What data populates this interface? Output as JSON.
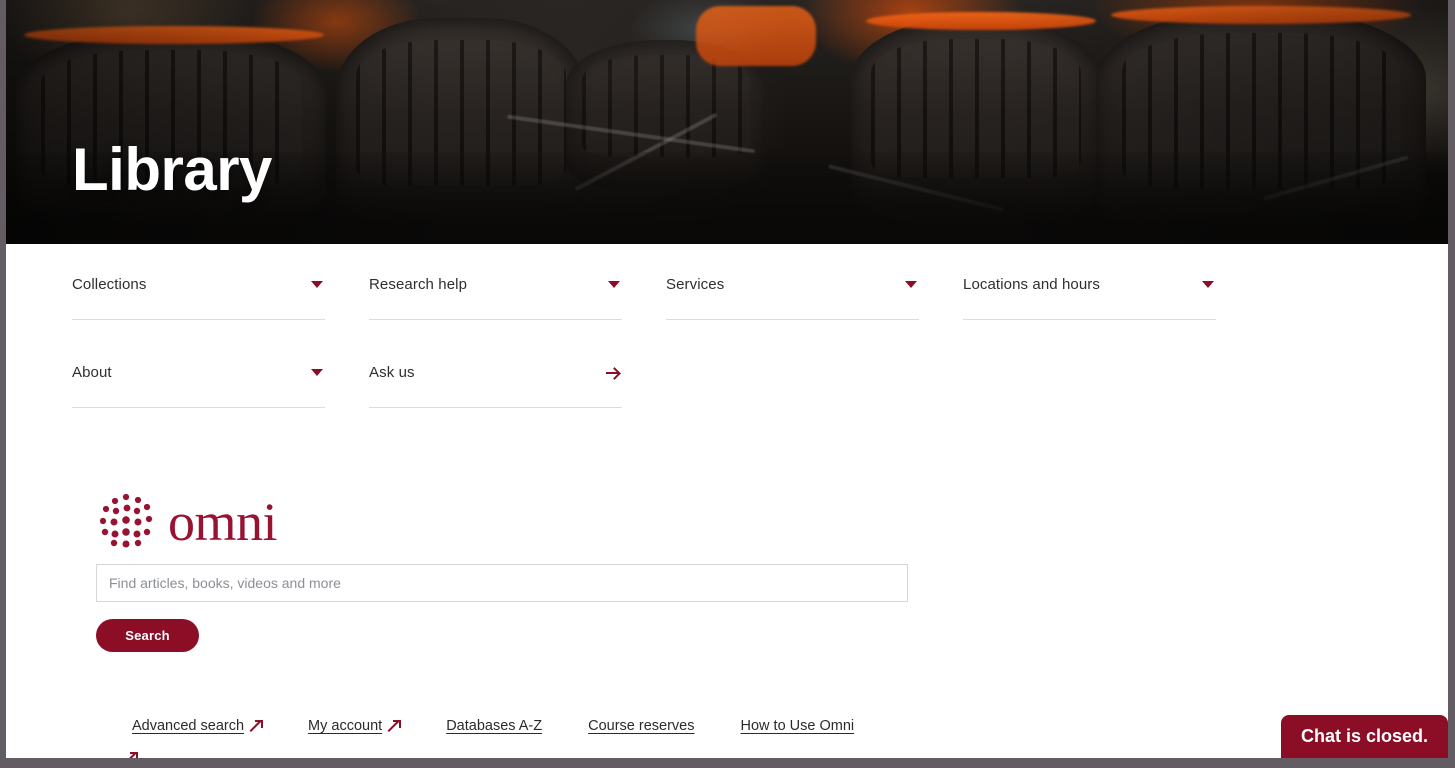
{
  "hero": {
    "title": "Library",
    "image_alt": "library-chairs-photo"
  },
  "nav": {
    "row1": [
      {
        "label": "Collections",
        "icon": "chevron-down-icon"
      },
      {
        "label": "Research help",
        "icon": "chevron-down-icon"
      },
      {
        "label": "Services",
        "icon": "chevron-down-icon"
      },
      {
        "label": "Locations and hours",
        "icon": "chevron-down-icon"
      }
    ],
    "row2": [
      {
        "label": "About",
        "icon": "chevron-down-icon"
      },
      {
        "label": "Ask us",
        "icon": "arrow-right-icon"
      }
    ]
  },
  "omni": {
    "logo_text": "omni",
    "logo_icon": "omni-dots-logo",
    "search_placeholder": "Find articles, books, videos and more",
    "search_value": "",
    "search_button": "Search"
  },
  "quick_links": [
    {
      "label": "Advanced search",
      "external": true
    },
    {
      "label": "My account",
      "external": true
    },
    {
      "label": "Databases A-Z",
      "external": false
    },
    {
      "label": "Course reserves",
      "external": false
    },
    {
      "label": "How to Use Omni",
      "external": false
    }
  ],
  "chat": {
    "label": "Chat is closed."
  },
  "colors": {
    "brand_red": "#8b0d26",
    "logo_red": "#981232",
    "text_dark": "#2f2f2f",
    "rule_gray": "#dcdcdc",
    "placeholder_gray": "#8b8f96",
    "chrome_gray": "#635c63"
  }
}
